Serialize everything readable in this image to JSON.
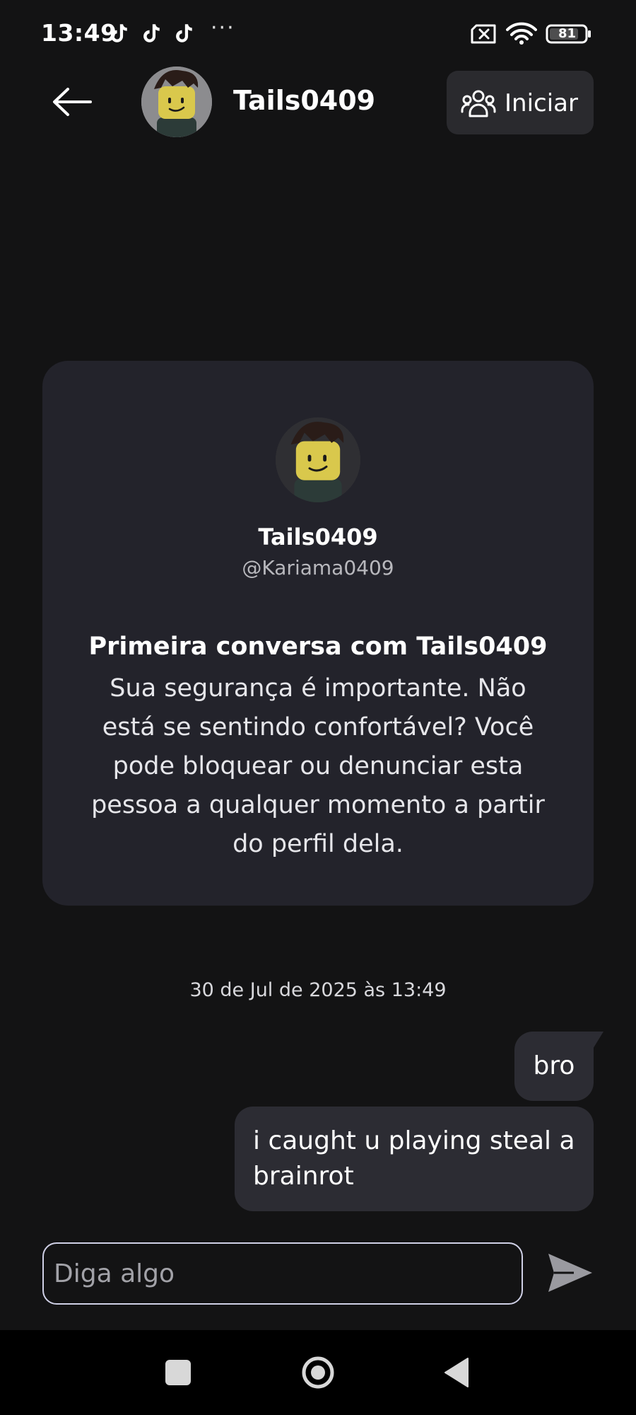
{
  "status_bar": {
    "time": "13:49",
    "notification_icons": [
      "tiktok-icon",
      "tiktok-icon",
      "tiktok-icon"
    ],
    "more": "···",
    "battery": "81"
  },
  "header": {
    "back_icon": "back-arrow-icon",
    "contact_name": "Tails0409",
    "start_button": {
      "icon": "people-group-icon",
      "label": "Iniciar"
    }
  },
  "intro_card": {
    "display_name": "Tails0409",
    "username": "@Kariama0409",
    "title": "Primeira conversa com Tails0409",
    "body": "Sua segurança é importante. Não está se sentindo confortável? Você pode bloquear ou denunciar esta pessoa a qualquer momento a partir do perfil dela."
  },
  "conversation": {
    "timestamp": "30 de Jul de 2025 às 13:49",
    "messages": [
      {
        "text": "bro",
        "sender": "self"
      },
      {
        "text": "i caught u playing steal a brainrot",
        "sender": "self"
      }
    ]
  },
  "composer": {
    "placeholder": "Diga algo",
    "value": "",
    "send_icon": "send-icon"
  },
  "nav_bar": {
    "icons": [
      "recent-apps-icon",
      "home-icon",
      "back-icon"
    ]
  },
  "colors": {
    "background": "#131314",
    "card": "#23232b",
    "bubble": "#2c2c33",
    "input_border": "#cfd0e6"
  }
}
